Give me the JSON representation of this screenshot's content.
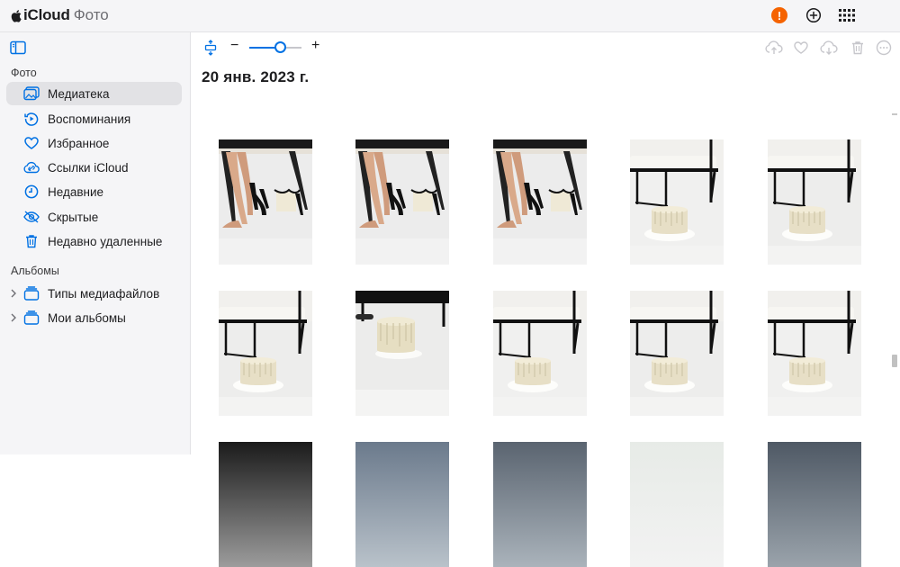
{
  "app": {
    "brand_icloud": "iCloud",
    "brand_photos": "Фото"
  },
  "topbar": {
    "alert_glyph": "!",
    "icons": [
      "alert-icon",
      "add-icon",
      "app-grid-icon"
    ]
  },
  "sidebar": {
    "section_photos": "Фото",
    "items": [
      {
        "label": "Медиатека",
        "icon": "library-icon",
        "active": true
      },
      {
        "label": "Воспоминания",
        "icon": "memories-icon"
      },
      {
        "label": "Избранное",
        "icon": "heart-icon"
      },
      {
        "label": "Ссылки iCloud",
        "icon": "icloud-links-icon"
      },
      {
        "label": "Недавние",
        "icon": "clock-icon"
      },
      {
        "label": "Скрытые",
        "icon": "hidden-eye-icon"
      },
      {
        "label": "Недавно удаленные",
        "icon": "trash-icon"
      }
    ],
    "section_albums": "Альбомы",
    "albums": [
      {
        "label": "Типы медиафайлов",
        "icon": "stack-icon"
      },
      {
        "label": "Мои альбомы",
        "icon": "stack-icon"
      }
    ]
  },
  "toolbar": {
    "zoom_minus": "−",
    "zoom_plus": "+",
    "zoom_level": 0.6
  },
  "main": {
    "date_heading": "20 янв. 2023 г."
  },
  "colors": {
    "accent": "#0071e3",
    "alert": "#f56300",
    "sidebar_bg": "#f5f5f7"
  }
}
